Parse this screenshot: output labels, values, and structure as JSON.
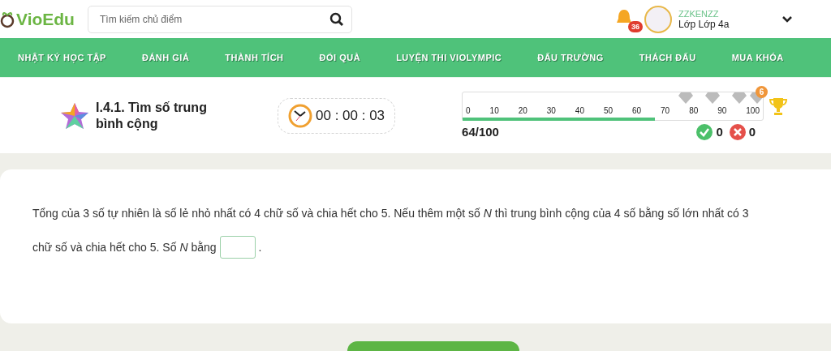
{
  "logo": {
    "text": "VioEdu"
  },
  "search": {
    "placeholder": "Tìm kiếm chủ điểm"
  },
  "notifications": {
    "count": "36"
  },
  "user": {
    "name": "ZZKENZZ",
    "class": "Lớp Lớp 4a"
  },
  "nav": [
    {
      "label": "NHẬT KÝ HỌC TẬP"
    },
    {
      "label": "ĐÁNH GIÁ"
    },
    {
      "label": "THÀNH TÍCH"
    },
    {
      "label": "ĐỔI QUÀ"
    },
    {
      "label": "LUYỆN THI VIOLYMPIC"
    },
    {
      "label": "ĐẤU TRƯỜNG"
    },
    {
      "label": "THÁCH ĐẤU"
    },
    {
      "label": "MUA KHÓA"
    }
  ],
  "lesson": {
    "title": "I.4.1. Tìm số trung bình cộng"
  },
  "timer": {
    "time": "00 : 00 : 03"
  },
  "progress": {
    "level": 0.64,
    "ticks": [
      "0",
      "10",
      "20",
      "30",
      "40",
      "50",
      "60",
      "70",
      "80",
      "90",
      "100"
    ],
    "gem_count": "6",
    "score": "64/100",
    "correct": "0",
    "wrong": "0"
  },
  "question": {
    "line_1": "Tổng của 3 số tự nhiên là số lẻ nhỏ nhất có 4 chữ số và chia hết cho 5. Nếu thêm một số *N* thì trung bình cộng của 4 số bằng số lớn nhất có 3",
    "line_2": "chữ số và chia hết cho 5. Số *N* bằng",
    "after": "."
  }
}
